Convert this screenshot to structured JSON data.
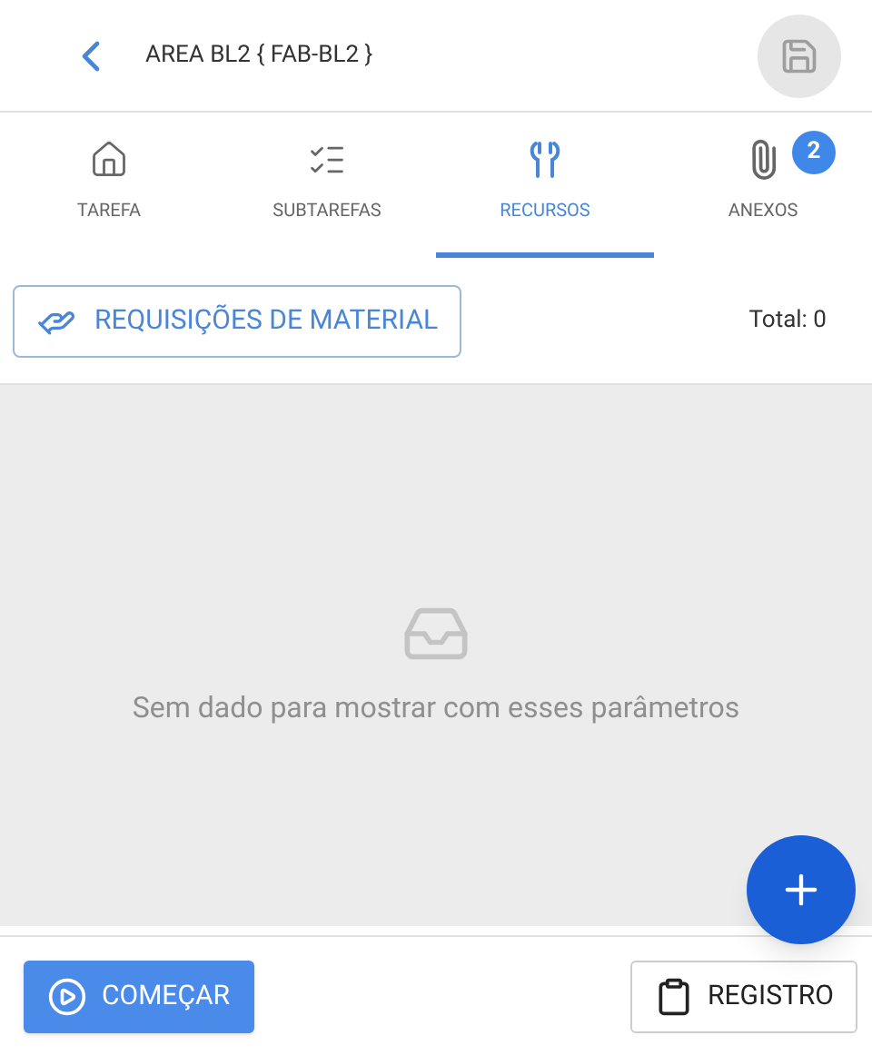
{
  "header": {
    "title": "AREA BL2 { FAB-BL2 }"
  },
  "tabs": [
    {
      "kind": "home",
      "label": "TAREFA",
      "selected": false
    },
    {
      "kind": "checklist",
      "label": "SUBTAREFAS",
      "selected": false
    },
    {
      "kind": "tools",
      "label": "RECURSOS",
      "selected": true
    },
    {
      "kind": "attachment",
      "label": "ANEXOS",
      "selected": false,
      "badge": "2"
    }
  ],
  "toolbar": {
    "button": "REQUISIÇÕES DE MATERIAL",
    "total": "Total: 0"
  },
  "empty_state": {
    "message": "Sem dado para mostrar com esses parâmetros"
  },
  "footer": {
    "start_button": "COMEÇAR",
    "log_button": "REGISTRO"
  }
}
